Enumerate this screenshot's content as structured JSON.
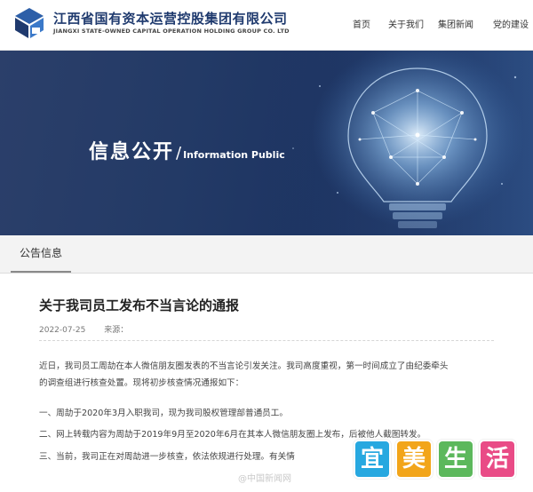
{
  "header": {
    "company_name_cn": "江西省国有资本运营控股集团有限公司",
    "company_name_en": "JIANGXI STATE-OWNED CAPITAL OPERATION HOLDING GROUP CO. LTD",
    "nav": [
      "首页",
      "关于我们",
      "集团新闻",
      "党的建设"
    ]
  },
  "banner": {
    "title_cn": "信息公开",
    "separator": "/",
    "title_en": "Information Public"
  },
  "section_tab": "公告信息",
  "article": {
    "title": "关于我司员工发布不当言论的通报",
    "date": "2022-07-25",
    "source_label": "来源：",
    "paragraphs": [
      "近日，我司员工周劼在本人微信朋友圈发表的不当言论引发关注。我司高度重视，第一时间成立了由纪委牵头",
      "的调查组进行核查处置。现将初步核查情况通报如下：",
      "一、周劼于2020年3月入职我司，现为我司股权管理部普通员工。",
      "二、网上转载内容为周劼于2019年9月至2020年6月在其本人微信朋友圈上发布，后被他人截图转发。",
      "三、当前，我司正在对周劼进一步核查，依法依规进行处理。有关情"
    ]
  },
  "watermark": {
    "text": "@中国新闻网",
    "stamp_chars": [
      "宜",
      "美",
      "生",
      "活"
    ],
    "stamp_colors": [
      "#27a8e0",
      "#f2a51a",
      "#5cb85c",
      "#e94b86"
    ]
  },
  "colors": {
    "brand_blue": "#1f3a6e",
    "banner_bg": "#233a66"
  }
}
